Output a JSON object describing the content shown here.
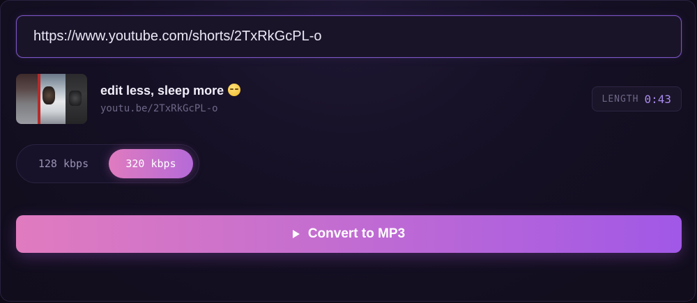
{
  "url_input": {
    "value": "https://www.youtube.com/shorts/2TxRkGcPL-o"
  },
  "video": {
    "title": "edit less, sleep more",
    "emoji_icon": "sleeping-face-icon",
    "link": "youtu.be/2TxRkGcPL-o",
    "length_label": "LENGTH",
    "length_value": "0:43"
  },
  "quality": {
    "options": [
      {
        "label": "128 kbps",
        "selected": false
      },
      {
        "label": "320 kbps",
        "selected": true
      }
    ]
  },
  "convert": {
    "label": "Convert to MP3",
    "icon": "play-icon"
  },
  "colors": {
    "accent_start": "#e07bbf",
    "accent_end": "#a158e6",
    "background": "#140f22",
    "input_border": "#7b55c4",
    "length_value": "#a98cf0"
  }
}
